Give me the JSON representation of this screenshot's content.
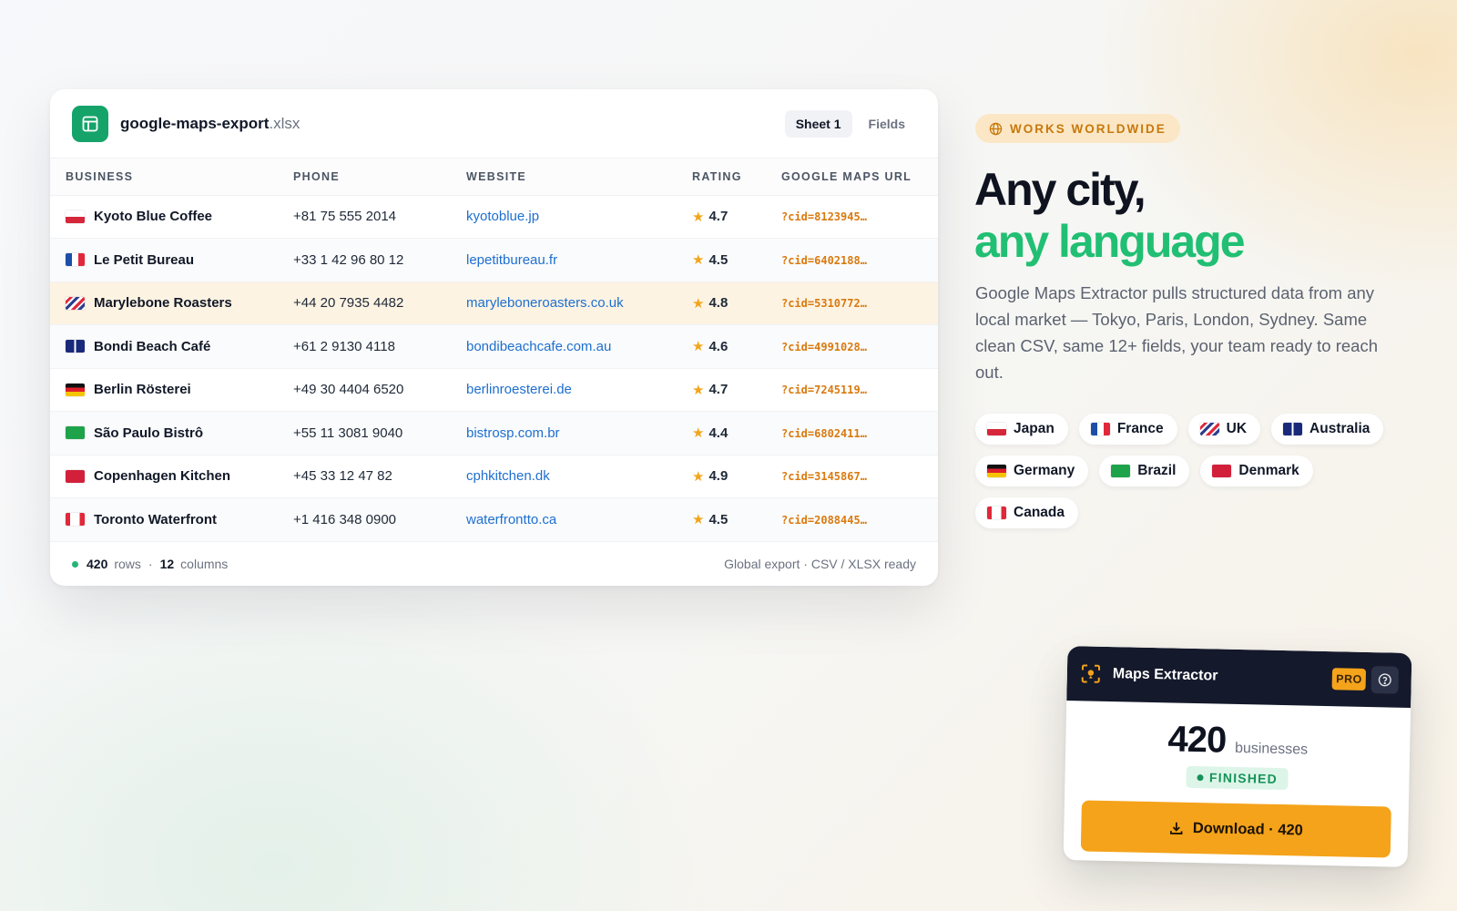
{
  "file": {
    "name": "google-maps-export",
    "ext": ".xlsx",
    "tabs": [
      {
        "label": "Sheet 1",
        "active": true
      },
      {
        "label": "Fields",
        "active": false
      }
    ]
  },
  "table": {
    "columns": [
      "BUSINESS",
      "PHONE",
      "WEBSITE",
      "RATING",
      "GOOGLE MAPS URL"
    ],
    "rows": [
      {
        "flag": "japan",
        "business": "Kyoto Blue Coffee",
        "phone": "+81 75 555 2014",
        "website": "kyotoblue.jp",
        "rating": "4.7",
        "url": "?cid=8123945…",
        "highlight": false
      },
      {
        "flag": "france",
        "business": "Le Petit Bureau",
        "phone": "+33 1 42 96 80 12",
        "website": "lepetitbureau.fr",
        "rating": "4.5",
        "url": "?cid=6402188…",
        "highlight": false
      },
      {
        "flag": "uk",
        "business": "Marylebone Roasters",
        "phone": "+44 20 7935 4482",
        "website": "maryleboneroasters.co.uk",
        "rating": "4.8",
        "url": "?cid=5310772…",
        "highlight": true
      },
      {
        "flag": "australia",
        "business": "Bondi Beach Café",
        "phone": "+61 2 9130 4118",
        "website": "bondibeachcafe.com.au",
        "rating": "4.6",
        "url": "?cid=4991028…",
        "highlight": false
      },
      {
        "flag": "germany",
        "business": "Berlin Rösterei",
        "phone": "+49 30 4404 6520",
        "website": "berlinroesterei.de",
        "rating": "4.7",
        "url": "?cid=7245119…",
        "highlight": false
      },
      {
        "flag": "brazil",
        "business": "São Paulo Bistrô",
        "phone": "+55 11 3081 9040",
        "website": "bistrosp.com.br",
        "rating": "4.4",
        "url": "?cid=6802411…",
        "highlight": false
      },
      {
        "flag": "denmark",
        "business": "Copenhagen Kitchen",
        "phone": "+45 33 12 47 82",
        "website": "cphkitchen.dk",
        "rating": "4.9",
        "url": "?cid=3145867…",
        "highlight": false
      },
      {
        "flag": "canada",
        "business": "Toronto Waterfront",
        "phone": "+1 416 348 0900",
        "website": "waterfrontto.ca",
        "rating": "4.5",
        "url": "?cid=2088445…",
        "highlight": false
      }
    ]
  },
  "footer": {
    "rows_count": "420",
    "rows_label": "rows",
    "separator": "·",
    "columns_count": "12",
    "columns_label": "columns",
    "right_text": "Global export · CSV / XLSX ready"
  },
  "hero": {
    "badge": "WORKS WORLDWIDE",
    "headline_line1": "Any city,",
    "headline_line2": "any language",
    "description": "Google Maps Extractor pulls structured data from any local market — Tokyo, Paris, London, Sydney. Same clean CSV, same 12+ fields, your team ready to reach out."
  },
  "countries": [
    {
      "flag": "japan",
      "label": "Japan"
    },
    {
      "flag": "france",
      "label": "France"
    },
    {
      "flag": "uk",
      "label": "UK"
    },
    {
      "flag": "australia",
      "label": "Australia"
    },
    {
      "flag": "germany",
      "label": "Germany"
    },
    {
      "flag": "brazil",
      "label": "Brazil"
    },
    {
      "flag": "denmark",
      "label": "Denmark"
    },
    {
      "flag": "canada",
      "label": "Canada"
    }
  ],
  "popup": {
    "title": "Maps Extractor",
    "pro": "PRO",
    "count": "420",
    "count_unit": "businesses",
    "status": "FINISHED",
    "download_label": "Download · 420"
  },
  "colors": {
    "accent_green": "#21bf73",
    "accent_orange": "#f5a31b",
    "link_blue": "#1d6fd0",
    "popup_dark": "#14192b"
  },
  "icons": {
    "file": "spreadsheet-icon",
    "badge": "globe-icon",
    "rating": "star-icon",
    "popup_logo": "map-pin-scan-icon",
    "help": "help-circle-icon",
    "download": "download-icon"
  }
}
